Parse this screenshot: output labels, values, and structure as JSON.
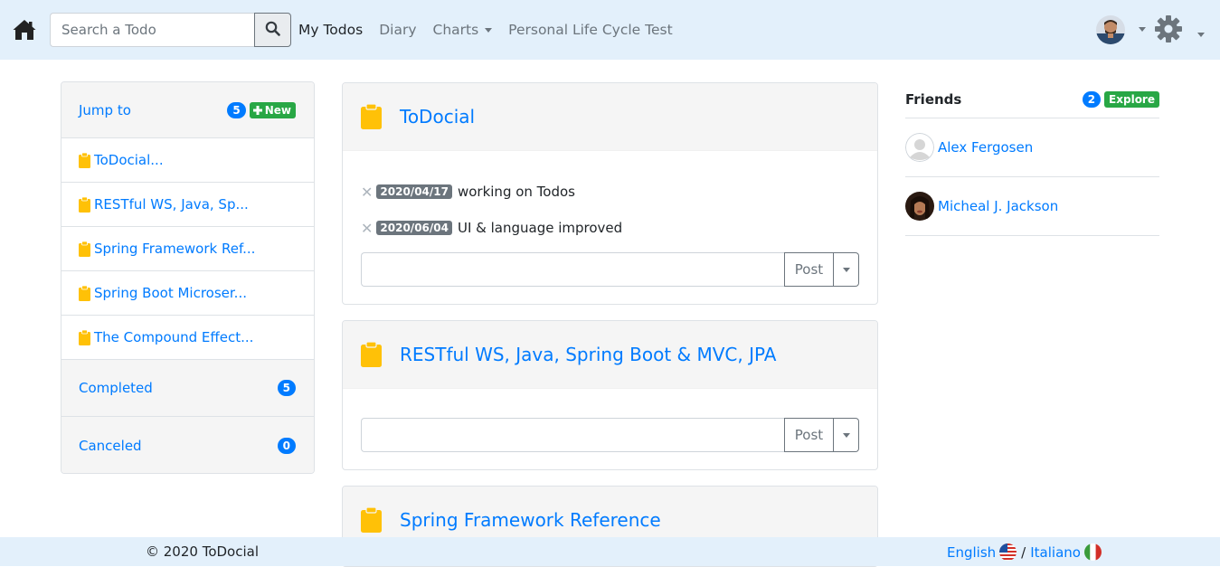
{
  "navbar": {
    "search": {
      "placeholder": "Search a Todo",
      "value": ""
    },
    "links": [
      {
        "label": "My Todos",
        "active": true
      },
      {
        "label": "Diary"
      },
      {
        "label": "Charts",
        "dropdown": true
      },
      {
        "label": "Personal Life Cycle Test"
      }
    ],
    "icons": {
      "home": "home-icon",
      "search": "search-icon",
      "settings": "gear-icon"
    }
  },
  "sidebar": {
    "jump_to": {
      "label": "Jump to",
      "count": "5",
      "new_label": "New"
    },
    "items": [
      {
        "label": "ToDocial..."
      },
      {
        "label": "RESTful WS, Java, Sp..."
      },
      {
        "label": "Spring Framework Ref..."
      },
      {
        "label": "Spring Boot Microser..."
      },
      {
        "label": "The Compound Effect..."
      }
    ],
    "completed": {
      "label": "Completed",
      "count": "5"
    },
    "canceled": {
      "label": "Canceled",
      "count": "0"
    }
  },
  "todos": [
    {
      "title": "ToDocial",
      "entries": [
        {
          "date": "2020/04/17",
          "text": "working on Todos"
        },
        {
          "date": "2020/06/04",
          "text": "UI & language improved"
        }
      ],
      "post_label": "Post"
    },
    {
      "title": "RESTful WS, Java, Spring Boot & MVC, JPA",
      "entries": [],
      "post_label": "Post"
    },
    {
      "title": "Spring Framework Reference",
      "entries": []
    }
  ],
  "friends": {
    "title": "Friends",
    "count": "2",
    "explore_label": "Explore",
    "list": [
      {
        "name": "Alex Fergosen"
      },
      {
        "name": "Micheal J. Jackson"
      }
    ]
  },
  "footer": {
    "copyright": "© 2020 ToDocial",
    "lang_en": "English",
    "separator": "/",
    "lang_it": "Italiano"
  },
  "colors": {
    "navbar_bg": "#e3f0fb",
    "link": "#007bff",
    "badge_blue": "#007bff",
    "badge_green": "#28a745",
    "clipboard": "#ffc107"
  }
}
